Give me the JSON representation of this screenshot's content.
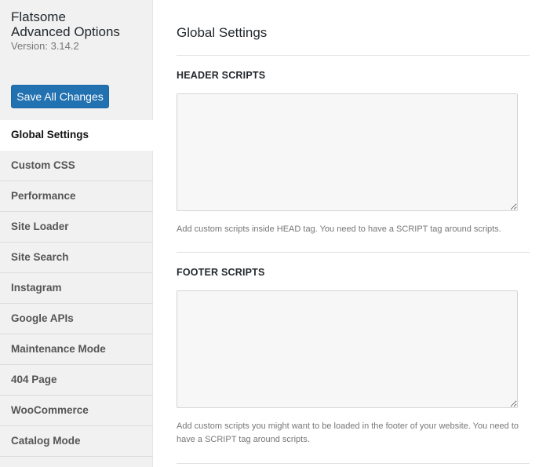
{
  "app": {
    "title_line1": "Flatsome",
    "title_line2": "Advanced Options",
    "version": "Version: 3.14.2"
  },
  "sidebar": {
    "save_label": "Save All Changes",
    "items": [
      {
        "label": "Global Settings",
        "active": true
      },
      {
        "label": "Custom CSS"
      },
      {
        "label": "Performance"
      },
      {
        "label": "Site Loader"
      },
      {
        "label": "Site Search"
      },
      {
        "label": "Instagram"
      },
      {
        "label": "Google APIs"
      },
      {
        "label": "Maintenance Mode"
      },
      {
        "label": "404 Page"
      },
      {
        "label": "WooCommerce"
      },
      {
        "label": "Catalog Mode"
      }
    ]
  },
  "main": {
    "title": "Global Settings",
    "header_scripts": {
      "label": "HEADER SCRIPTS",
      "value": "",
      "help": "Add custom scripts inside HEAD tag. You need to have a SCRIPT tag around scripts."
    },
    "footer_scripts": {
      "label": "FOOTER SCRIPTS",
      "value": "",
      "help": "Add custom scripts you might want to be loaded in the footer of your website. You need to have a SCRIPT tag around scripts."
    }
  },
  "colors": {
    "accent": "#2271b1",
    "sidebar_bg": "#f1f1f1"
  }
}
